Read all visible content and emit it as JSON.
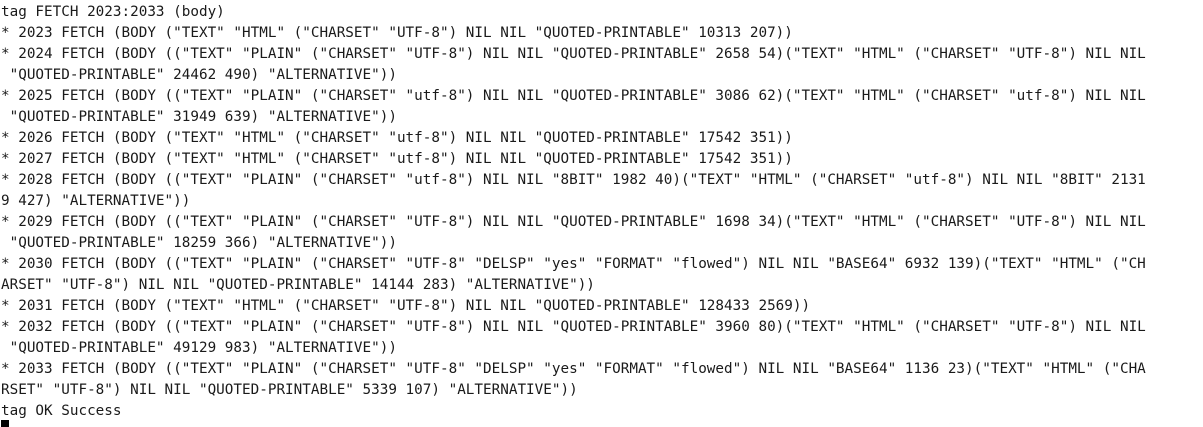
{
  "terminal": {
    "lines": [
      "tag FETCH 2023:2033 (body)",
      "* 2023 FETCH (BODY (\"TEXT\" \"HTML\" (\"CHARSET\" \"UTF-8\") NIL NIL \"QUOTED-PRINTABLE\" 10313 207))",
      "* 2024 FETCH (BODY ((\"TEXT\" \"PLAIN\" (\"CHARSET\" \"UTF-8\") NIL NIL \"QUOTED-PRINTABLE\" 2658 54)(\"TEXT\" \"HTML\" (\"CHARSET\" \"UTF-8\") NIL NIL",
      " \"QUOTED-PRINTABLE\" 24462 490) \"ALTERNATIVE\"))",
      "* 2025 FETCH (BODY ((\"TEXT\" \"PLAIN\" (\"CHARSET\" \"utf-8\") NIL NIL \"QUOTED-PRINTABLE\" 3086 62)(\"TEXT\" \"HTML\" (\"CHARSET\" \"utf-8\") NIL NIL",
      " \"QUOTED-PRINTABLE\" 31949 639) \"ALTERNATIVE\"))",
      "* 2026 FETCH (BODY (\"TEXT\" \"HTML\" (\"CHARSET\" \"utf-8\") NIL NIL \"QUOTED-PRINTABLE\" 17542 351))",
      "* 2027 FETCH (BODY (\"TEXT\" \"HTML\" (\"CHARSET\" \"utf-8\") NIL NIL \"QUOTED-PRINTABLE\" 17542 351))",
      "* 2028 FETCH (BODY ((\"TEXT\" \"PLAIN\" (\"CHARSET\" \"utf-8\") NIL NIL \"8BIT\" 1982 40)(\"TEXT\" \"HTML\" (\"CHARSET\" \"utf-8\") NIL NIL \"8BIT\" 2131",
      "9 427) \"ALTERNATIVE\"))",
      "* 2029 FETCH (BODY ((\"TEXT\" \"PLAIN\" (\"CHARSET\" \"UTF-8\") NIL NIL \"QUOTED-PRINTABLE\" 1698 34)(\"TEXT\" \"HTML\" (\"CHARSET\" \"UTF-8\") NIL NIL",
      " \"QUOTED-PRINTABLE\" 18259 366) \"ALTERNATIVE\"))",
      "* 2030 FETCH (BODY ((\"TEXT\" \"PLAIN\" (\"CHARSET\" \"UTF-8\" \"DELSP\" \"yes\" \"FORMAT\" \"flowed\") NIL NIL \"BASE64\" 6932 139)(\"TEXT\" \"HTML\" (\"CH",
      "ARSET\" \"UTF-8\") NIL NIL \"QUOTED-PRINTABLE\" 14144 283) \"ALTERNATIVE\"))",
      "* 2031 FETCH (BODY (\"TEXT\" \"HTML\" (\"CHARSET\" \"UTF-8\") NIL NIL \"QUOTED-PRINTABLE\" 128433 2569))",
      "* 2032 FETCH (BODY ((\"TEXT\" \"PLAIN\" (\"CHARSET\" \"UTF-8\") NIL NIL \"QUOTED-PRINTABLE\" 3960 80)(\"TEXT\" \"HTML\" (\"CHARSET\" \"UTF-8\") NIL NIL",
      " \"QUOTED-PRINTABLE\" 49129 983) \"ALTERNATIVE\"))",
      "* 2033 FETCH (BODY ((\"TEXT\" \"PLAIN\" (\"CHARSET\" \"UTF-8\" \"DELSP\" \"yes\" \"FORMAT\" \"flowed\") NIL NIL \"BASE64\" 1136 23)(\"TEXT\" \"HTML\" (\"CHA",
      "RSET\" \"UTF-8\") NIL NIL \"QUOTED-PRINTABLE\" 5339 107) \"ALTERNATIVE\"))",
      "tag OK Success"
    ]
  }
}
